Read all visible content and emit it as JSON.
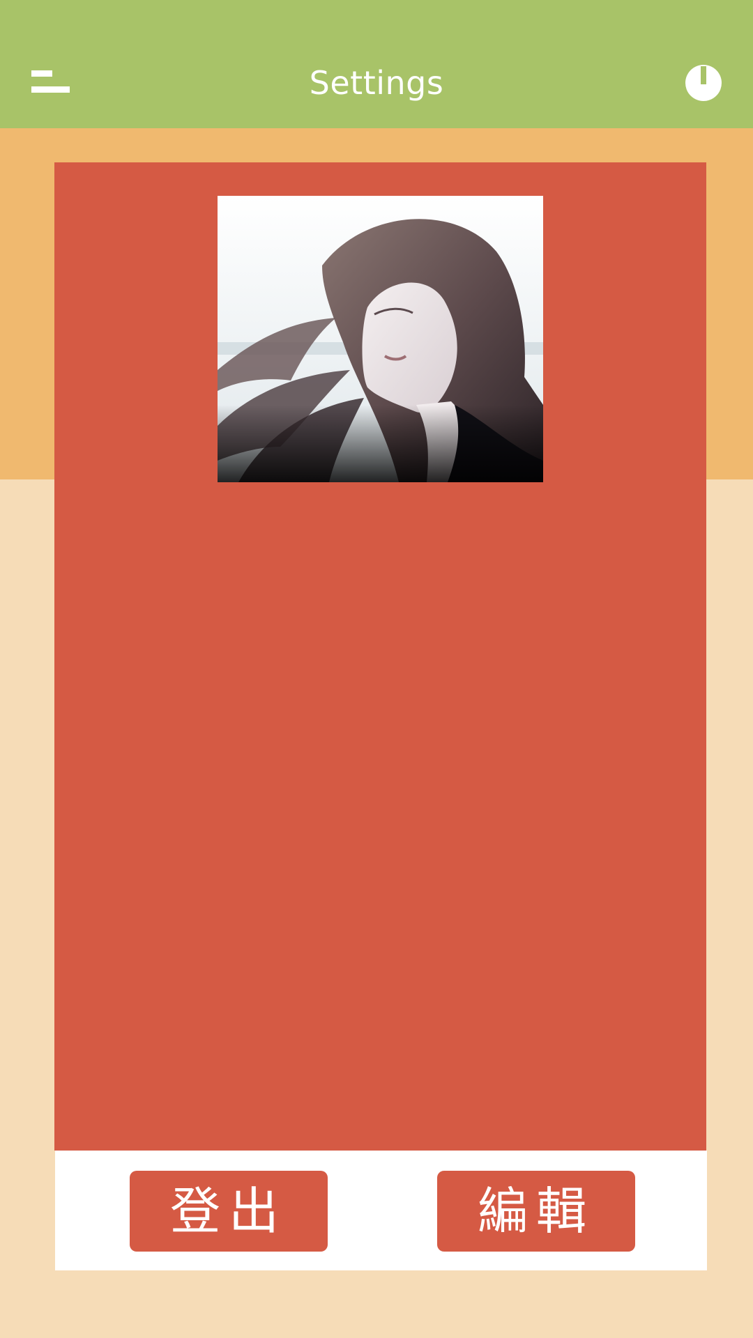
{
  "header": {
    "title": "Settings",
    "menu_icon": "menu-icon",
    "power_icon": "power-icon"
  },
  "profile": {
    "avatar_icon": "profile-photo"
  },
  "actions": {
    "logout_label": "登出",
    "edit_label": "編輯"
  },
  "colors": {
    "header_bg": "#a8c368",
    "orange_band": "#f0b96f",
    "page_bg": "#f6dcb7",
    "card_bg": "#d55a44",
    "button_bg": "#d55a44",
    "panel_bg": "#ffffff"
  }
}
